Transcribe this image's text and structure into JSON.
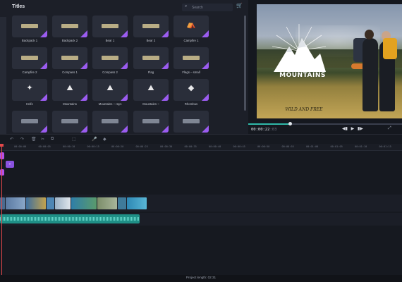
{
  "titles_panel": {
    "title": "Titles",
    "search_placeholder": "Search",
    "tiles": [
      {
        "label": "Backpack 1"
      },
      {
        "label": "Backpack 2"
      },
      {
        "label": "Bear 1"
      },
      {
        "label": "Bear 2"
      },
      {
        "label": "Campfire 1"
      },
      {
        "label": "Campfire 2"
      },
      {
        "label": "Compass 1"
      },
      {
        "label": "Compass 2"
      },
      {
        "label": "Flag"
      },
      {
        "label": "Flags – small"
      },
      {
        "label": "Knife"
      },
      {
        "label": "Mountains"
      },
      {
        "label": "Mountains – rays"
      },
      {
        "label": "Mountains ~"
      },
      {
        "label": "Rhombus"
      },
      {
        "label": ""
      },
      {
        "label": ""
      },
      {
        "label": ""
      },
      {
        "label": ""
      },
      {
        "label": ""
      }
    ]
  },
  "preview": {
    "title_text": "MOUNTAINS",
    "subtitle_text": "WILD AND FREE",
    "timecode": "00:00:22",
    "timecode_frames": ":03",
    "playback_progress": 0.27
  },
  "timeline": {
    "ruler_ticks": [
      "00:00:00",
      "00:00:05",
      "00:00:10",
      "00:00:15",
      "00:00:20",
      "00:00:25",
      "00:00:30",
      "00:00:35",
      "00:00:40",
      "00:00:45",
      "00:00:50",
      "00:00:55",
      "00:01:00",
      "00:01:05",
      "00:01:10",
      "00:01:15"
    ],
    "title_clip_label": "T",
    "project_length": "Project length: 02:31"
  },
  "icons": {
    "search": "search-icon",
    "cart": "cart-icon",
    "play": "play-icon",
    "prev": "previous-frame-icon",
    "next": "next-frame-icon",
    "mic": "microphone-icon",
    "undo": "undo-icon",
    "redo": "redo-icon"
  },
  "colors": {
    "accent_purple": "#9b5cf0",
    "accent_teal": "#2fb8a8",
    "playhead": "#e2484a",
    "audio_clip": "#1f8f86"
  }
}
